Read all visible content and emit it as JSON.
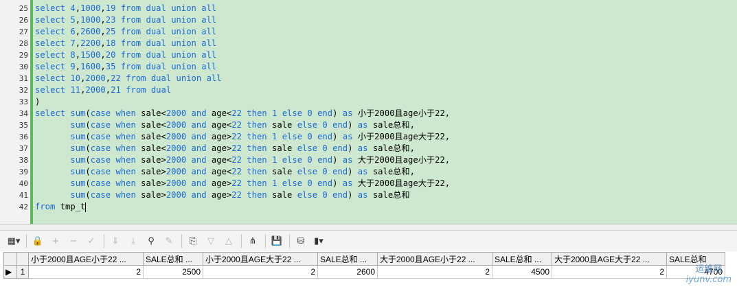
{
  "editor": {
    "lines": [
      {
        "no": "25",
        "code": "select 4,1000,19 from dual union all"
      },
      {
        "no": "26",
        "code": "select 5,1000,23 from dual union all"
      },
      {
        "no": "27",
        "code": "select 6,2600,25 from dual union all"
      },
      {
        "no": "28",
        "code": "select 7,2200,18 from dual union all"
      },
      {
        "no": "29",
        "code": "select 8,1500,20 from dual union all"
      },
      {
        "no": "30",
        "code": "select 9,1600,35 from dual union all"
      },
      {
        "no": "31",
        "code": "select 10,2000,22 from dual union all"
      },
      {
        "no": "32",
        "code": "select 11,2000,21 from dual"
      },
      {
        "no": "33",
        "code": ")"
      },
      {
        "no": "34",
        "code": "select sum(case when sale<2000 and age<22 then 1 else 0 end) as 小于2000且age小于22,"
      },
      {
        "no": "35",
        "code": "       sum(case when sale<2000 and age<22 then sale else 0 end) as sale总和,"
      },
      {
        "no": "36",
        "code": "       sum(case when sale<2000 and age>22 then 1 else 0 end) as 小于2000且age大于22,"
      },
      {
        "no": "37",
        "code": "       sum(case when sale<2000 and age>22 then sale else 0 end) as sale总和,"
      },
      {
        "no": "38",
        "code": "       sum(case when sale>2000 and age<22 then 1 else 0 end) as 大于2000且age小于22,"
      },
      {
        "no": "39",
        "code": "       sum(case when sale>2000 and age<22 then sale else 0 end) as sale总和,"
      },
      {
        "no": "40",
        "code": "       sum(case when sale>2000 and age>22 then 1 else 0 end) as 大于2000且age大于22,"
      },
      {
        "no": "41",
        "code": "       sum(case when sale>2000 and age>22 then sale else 0 end) as sale总和"
      },
      {
        "no": "42",
        "code": "from tmp_t"
      }
    ]
  },
  "toolbar": {
    "icons": [
      "grid-menu-icon",
      "lock-icon",
      "add-row-icon",
      "delete-row-icon",
      "post-icon",
      "next-page-icon",
      "last-page-icon",
      "find-icon",
      "clear-icon",
      "export-icon",
      "sort-down-icon",
      "sort-up-icon",
      "query-by-example-icon",
      "save-icon",
      "fetch-icon",
      "chart-icon"
    ]
  },
  "results": {
    "columns": [
      "小于2000且AGE小于22 ...",
      "SALE总和 ...",
      "小于2000且AGE大于22 ...",
      "SALE总和 ...",
      "大于2000且AGE小于22 ...",
      "SALE总和 ...",
      "大于2000且AGE大于22 ...",
      "SALE总和"
    ],
    "rows": [
      {
        "num": "1",
        "cells": [
          "2",
          "2500",
          "2",
          "2600",
          "2",
          "4500",
          "2",
          "4700"
        ]
      }
    ]
  },
  "watermark": {
    "top": "运维网",
    "bottom": "iyunv.com"
  }
}
